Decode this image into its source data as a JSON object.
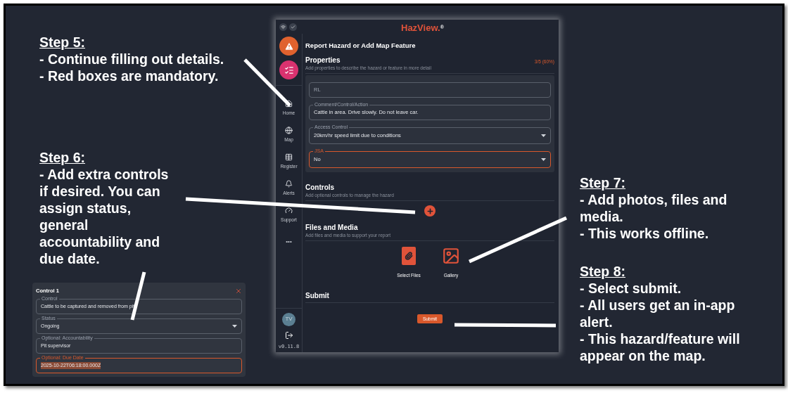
{
  "steps": [
    {
      "heading": "Step 5:",
      "lines": [
        "- Continue filling out details.",
        "- Red boxes are mandatory."
      ]
    },
    {
      "heading": "Step 6:",
      "lines": [
        "- Add extra controls if desired. You can assign status, general accountability and due date."
      ]
    },
    {
      "heading": "Step 7:",
      "lines": [
        "- Add photos, files and media.",
        "- This works offline."
      ]
    },
    {
      "heading": "Step 8:",
      "lines": [
        "- Select submit.",
        "- All users get an in-app alert.",
        "- This hazard/feature will appear on the map."
      ]
    }
  ],
  "control_card": {
    "title": "Control 1",
    "fields": [
      {
        "label": "Control",
        "value": "Cattle to be captured and removed from pit",
        "kind": "text",
        "required": false
      },
      {
        "label": "Status",
        "value": "Ongoing",
        "kind": "select",
        "required": false
      },
      {
        "label": "Optional: Accountability",
        "value": "Pit supervisor",
        "kind": "text",
        "required": false
      },
      {
        "label": "Optional: Due Date",
        "value": "2025-10-22T06:18:00.000Z",
        "kind": "text",
        "required": true,
        "highlighted": true
      }
    ]
  },
  "app": {
    "logo": "HazView.",
    "logo_mark": "®",
    "nav": [
      {
        "label": "Home",
        "kind": "home"
      },
      {
        "label": "Map",
        "kind": "map"
      },
      {
        "label": "Register",
        "kind": "register"
      },
      {
        "label": "Alerts",
        "kind": "alerts"
      },
      {
        "label": "Support",
        "kind": "support"
      },
      {
        "label": "•••",
        "kind": "more"
      }
    ],
    "avatar": "TV",
    "version": "v0.11.8",
    "title": "Report Hazard or Add Map Feature",
    "properties": {
      "heading": "Properties",
      "subtitle": "Add properties to describe the hazard or feature in more detail",
      "progress": "3/5 (60%)",
      "fields": [
        {
          "placeholder": "RL",
          "kind": "text",
          "required": false
        },
        {
          "label": "Comment/Control/Action",
          "value": "Cattle in area. Drive slowly. Do not leave car.",
          "kind": "text",
          "required": false
        },
        {
          "label": "Access Control",
          "value": "20km/hr speed limit due to conditions",
          "kind": "select",
          "required": false
        },
        {
          "label": "JSA",
          "value": "No",
          "kind": "select",
          "required": true
        }
      ]
    },
    "controls": {
      "heading": "Controls",
      "subtitle": "Add optional controls to manage the hazard"
    },
    "files": {
      "heading": "Files and Media",
      "subtitle": "Add files and media to support your report",
      "actions": [
        {
          "label": "Select Files",
          "kind": "file"
        },
        {
          "label": "Gallery",
          "kind": "image"
        }
      ]
    },
    "submit": {
      "heading": "Submit",
      "button": "Submit"
    }
  }
}
